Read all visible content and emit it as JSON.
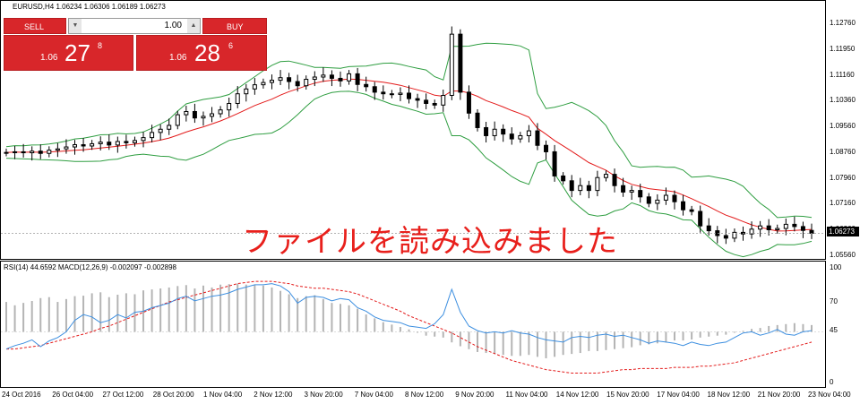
{
  "chart": {
    "title": "EURUSD,H4  1.06234 1.06306 1.06189 1.06273",
    "current_price": "1.06273",
    "price_ticks": [
      "1.12760",
      "1.11950",
      "1.11160",
      "1.10360",
      "1.09560",
      "1.08760",
      "1.07960",
      "1.07160",
      "1.06360",
      "1.05560"
    ],
    "indicator_title": "RSI(14) 44.6592  MACD(12,26,9) -0.002097 -0.002898",
    "indicator_ticks": [
      "100",
      "70",
      "45",
      "0"
    ],
    "x_ticks": [
      "24 Oct 2016",
      "26 Oct 04:00",
      "27 Oct 12:00",
      "28 Oct 20:00",
      "1 Nov 04:00",
      "2 Nov 12:00",
      "3 Nov 20:00",
      "7 Nov 04:00",
      "8 Nov 12:00",
      "9 Nov 20:00",
      "11 Nov 04:00",
      "14 Nov 12:00",
      "15 Nov 20:00",
      "17 Nov 04:00",
      "18 Nov 12:00",
      "21 Nov 20:00",
      "23 Nov 04:00"
    ]
  },
  "trade_panel": {
    "sell_label": "SELL",
    "buy_label": "BUY",
    "lot_value": "1.00",
    "sell_prefix": "1.06",
    "sell_big": "27",
    "sell_sup": "8",
    "buy_prefix": "1.06",
    "buy_big": "28",
    "buy_sup": "6"
  },
  "overlay_text": "ファイルを読み込みました",
  "colors": {
    "sell": "#d8262a",
    "band": "#2f9e41",
    "ma": "#e31b1b",
    "rsi": "#3d8fe0",
    "macd_signal": "#e31b1b",
    "histogram": "#b4b4b4",
    "overlay": "#e8201c"
  },
  "chart_data": {
    "type": "candlestick",
    "y_range": [
      1.0556,
      1.1276
    ],
    "indicator_range": [
      0,
      100
    ],
    "closes": [
      1.0878,
      1.088,
      1.0877,
      1.0882,
      1.0875,
      1.0885,
      1.0889,
      1.0895,
      1.0902,
      1.0898,
      1.0905,
      1.091,
      1.0901,
      1.0912,
      1.0908,
      1.0915,
      1.0924,
      1.094,
      1.095,
      1.0962,
      1.0995,
      1.1005,
      1.0985,
      1.099,
      1.0998,
      1.101,
      1.103,
      1.106,
      1.1075,
      1.1088,
      1.1095,
      1.1102,
      1.111,
      1.1098,
      1.1085,
      1.1105,
      1.1112,
      1.1118,
      1.1108,
      1.11,
      1.1122,
      1.1089,
      1.1082,
      1.1065,
      1.106,
      1.1058,
      1.1062,
      1.1045,
      1.104,
      1.103,
      1.1025,
      1.1055,
      1.1245,
      1.1065,
      1.1,
      1.0955,
      1.093,
      1.095,
      1.0935,
      1.092,
      1.093,
      1.0945,
      1.09,
      1.088,
      1.0805,
      1.079,
      1.076,
      1.0775,
      1.076,
      1.08,
      1.081,
      1.0775,
      1.0755,
      1.076,
      1.074,
      1.072,
      1.073,
      1.0745,
      1.0725,
      1.07,
      1.0695,
      1.065,
      1.0635,
      1.062,
      1.0612,
      1.063,
      1.0625,
      1.064,
      1.065,
      1.0638,
      1.0642,
      1.0655,
      1.0648,
      1.0636,
      1.0627
    ],
    "rsi": [
      30,
      33,
      35,
      38,
      32,
      37,
      40,
      45,
      55,
      60,
      58,
      53,
      55,
      60,
      57,
      62,
      63,
      66,
      68,
      70,
      74,
      76,
      72,
      74,
      76,
      77,
      79,
      82,
      84,
      86,
      86,
      87,
      85,
      80,
      70,
      75,
      76,
      75,
      72,
      74,
      73,
      66,
      63,
      58,
      55,
      54,
      53,
      50,
      49,
      48,
      52,
      60,
      82,
      62,
      50,
      46,
      44,
      45,
      44,
      46,
      44,
      43,
      40,
      38,
      37,
      36,
      40,
      41,
      40,
      42,
      43,
      41,
      42,
      40,
      38,
      35,
      37,
      36,
      35,
      33,
      36,
      34,
      33,
      35,
      36,
      40,
      44,
      45,
      42,
      44,
      47,
      43,
      42,
      45,
      46
    ],
    "macd_signal": [
      30,
      30,
      31,
      32,
      33,
      35,
      37,
      39,
      41,
      43,
      45,
      48,
      50,
      53,
      56,
      59,
      62,
      65,
      68,
      71,
      73,
      75,
      77,
      79,
      81,
      83,
      85,
      87,
      88,
      89,
      89,
      89,
      88,
      87,
      85,
      84,
      83,
      83,
      82,
      81,
      80,
      78,
      75,
      72,
      69,
      66,
      63,
      59,
      56,
      53,
      50,
      47,
      44,
      40,
      36,
      32,
      29,
      26,
      23,
      20,
      18,
      16,
      14,
      12,
      11,
      10,
      9,
      9,
      9,
      9,
      10,
      11,
      12,
      12,
      13,
      13,
      13,
      13,
      14,
      14,
      14,
      15,
      15,
      16,
      17,
      18,
      20,
      22,
      24,
      26,
      28,
      30,
      32,
      34,
      36
    ],
    "macd_hist": [
      62,
      55,
      60,
      64,
      70,
      72,
      62,
      68,
      74,
      75,
      80,
      82,
      72,
      77,
      80,
      78,
      86,
      88,
      90,
      92,
      95,
      97,
      90,
      96,
      92,
      98,
      99,
      100,
      98,
      97,
      96,
      92,
      85,
      78,
      70,
      74,
      76,
      68,
      60,
      58,
      55,
      48,
      36,
      28,
      20,
      15,
      10,
      5,
      -2,
      -8,
      -10,
      -12,
      -22,
      -30,
      -36,
      -42,
      -44,
      -46,
      -48,
      -50,
      -50,
      -48,
      -52,
      -55,
      -52,
      -48,
      -46,
      -44,
      -40,
      -40,
      -38,
      -36,
      -34,
      -32,
      -28,
      -26,
      -24,
      -22,
      -18,
      -18,
      -16,
      -12,
      -10,
      -8,
      -6,
      -2,
      2,
      6,
      8,
      12,
      14,
      16,
      18,
      16,
      14
    ]
  }
}
